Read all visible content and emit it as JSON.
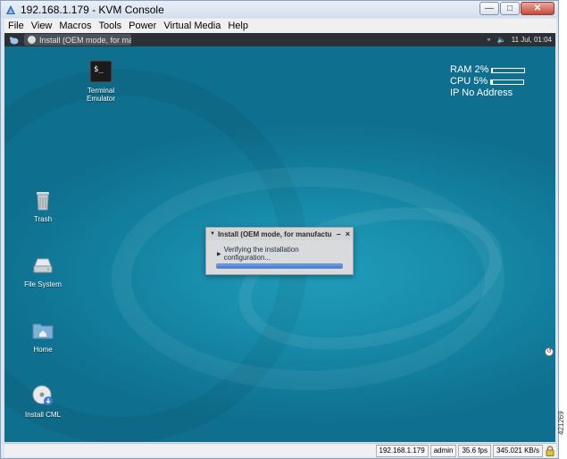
{
  "window": {
    "title": "192.168.1.179 - KVM Console"
  },
  "menubar": {
    "items": [
      "File",
      "View",
      "Macros",
      "Tools",
      "Power",
      "Virtual Media",
      "Help"
    ]
  },
  "taskbar": {
    "task_label": "Install (OEM mode, for manu...",
    "clock": "11 Jul, 01:04"
  },
  "sysmon": {
    "ram_label": "RAM 2%",
    "ram_level": 0.02,
    "cpu_label": "CPU 5%",
    "cpu_level": 0.05,
    "ip_label": "IP  No Address"
  },
  "desktop_icons": [
    {
      "label": "Terminal Emulator",
      "icon": "terminal-icon"
    },
    {
      "label": "Trash",
      "icon": "trash-icon"
    },
    {
      "label": "File System",
      "icon": "drive-icon"
    },
    {
      "label": "Home",
      "icon": "home-folder-icon"
    },
    {
      "label": "Install CML",
      "icon": "disc-install-icon"
    }
  ],
  "dialog": {
    "title": "Install (OEM mode, for manufactu",
    "status": "Verifying the installation configuration...",
    "progress": 1.0
  },
  "statusbar": {
    "host": "192.168.1.179",
    "user": "admin",
    "fps": "35.6 fps",
    "rate": "345.021 KB/s"
  },
  "figure_id": "421269",
  "colors": {
    "desktop": "#1a8fae",
    "progress": "#3d78d6"
  }
}
